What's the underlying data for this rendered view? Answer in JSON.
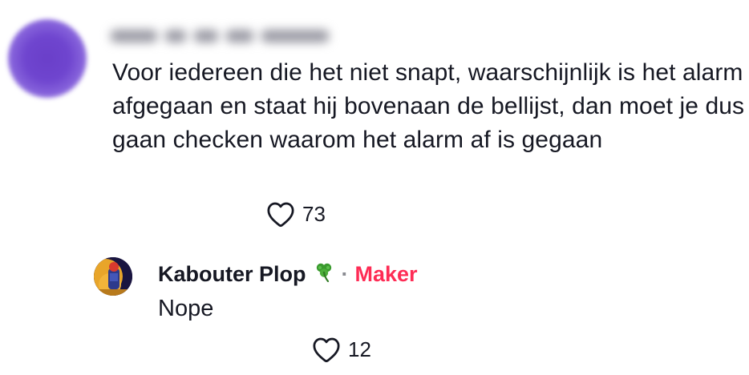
{
  "comment": {
    "author_display": "(blurred)",
    "text": "Voor iedereen die het niet snapt, waarschijnlijk is het alarm afgegaan en staat hij bovenaan de bellijst, dan moet je dus gaan checken waarom het alarm af is gegaan",
    "likes": "73",
    "like_icon": "heart-outline-icon"
  },
  "reply": {
    "author": "Kabouter Plop",
    "author_emoji": "☘️",
    "separator": "·",
    "badge": "Maker",
    "text": "Nope",
    "likes": "12",
    "like_icon": "heart-outline-icon"
  },
  "colors": {
    "text": "#161823",
    "maker_badge": "#fe2c55",
    "muted": "#8a8b91"
  }
}
